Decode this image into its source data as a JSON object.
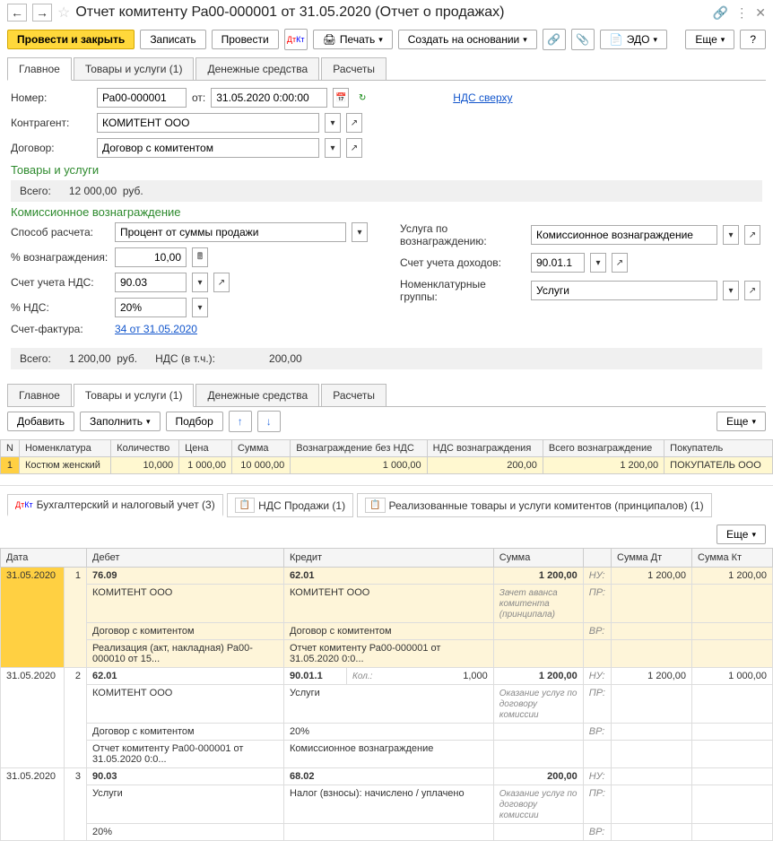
{
  "header": {
    "title": "Отчет комитенту Ра00-000001 от 31.05.2020 (Отчет о продажах)"
  },
  "toolbar": {
    "post_close": "Провести и закрыть",
    "save": "Записать",
    "post": "Провести",
    "print": "Печать",
    "create_based": "Создать на основании",
    "edo": "ЭДО",
    "more": "Еще",
    "help": "?"
  },
  "tabs1": {
    "main": "Главное",
    "goods": "Товары и услуги (1)",
    "money": "Денежные средства",
    "calc": "Расчеты"
  },
  "form": {
    "number_label": "Номер:",
    "number": "Ра00-000001",
    "from_label": "от:",
    "date": "31.05.2020 0:00:00",
    "vat_link": "НДС сверху",
    "contragent_label": "Контрагент:",
    "contragent": "КОМИТЕНТ ООО",
    "contract_label": "Договор:",
    "contract": "Договор с комитентом"
  },
  "goods_section": {
    "title": "Товары и услуги",
    "total_label": "Всего:",
    "total": "12 000,00",
    "currency": "руб."
  },
  "commission": {
    "title": "Комиссионное вознаграждение",
    "method_label": "Способ расчета:",
    "method": "Процент от суммы продажи",
    "service_label": "Услуга по вознаграждению:",
    "service": "Комиссионное вознаграждение",
    "percent_label": "% вознаграждения:",
    "percent": "10,00",
    "income_acct_label": "Счет учета доходов:",
    "income_acct": "90.01.1",
    "vat_acct_label": "Счет учета НДС:",
    "vat_acct": "90.03",
    "nom_group_label": "Номенклатурные группы:",
    "nom_group": "Услуги",
    "vat_rate_label": "% НДС:",
    "vat_rate": "20%",
    "invoice_label": "Счет-фактура:",
    "invoice": "34 от 31.05.2020",
    "totals_label": "Всего:",
    "totals_amount": "1 200,00",
    "totals_currency": "руб.",
    "vat_incl_label": "НДС (в т.ч.):",
    "vat_incl": "200,00"
  },
  "goods_toolbar": {
    "add": "Добавить",
    "fill": "Заполнить",
    "pick": "Подбор",
    "more": "Еще"
  },
  "goods_table": {
    "headers": {
      "n": "N",
      "nom": "Номенклатура",
      "qty": "Количество",
      "price": "Цена",
      "sum": "Сумма",
      "reward_novat": "Вознаграждение без НДС",
      "reward_vat": "НДС вознаграждения",
      "reward_total": "Всего вознаграждение",
      "buyer": "Покупатель"
    },
    "rows": [
      {
        "n": "1",
        "nom": "Костюм женский",
        "qty": "10,000",
        "price": "1 000,00",
        "sum": "10 000,00",
        "reward_novat": "1 000,00",
        "reward_vat": "200,00",
        "reward_total": "1 200,00",
        "buyer": "ПОКУПАТЕЛЬ ООО"
      }
    ]
  },
  "acct_tabs": {
    "acct": "Бухгалтерский и налоговый учет (3)",
    "vat_sales": "НДС Продажи (1)",
    "realized": "Реализованные товары и услуги комитентов (принципалов) (1)"
  },
  "acct_headers": {
    "date": "Дата",
    "debit": "Дебет",
    "credit": "Кредит",
    "sum": "Сумма",
    "sum_dt": "Сумма Дт",
    "sum_kt": "Сумма Кт"
  },
  "acct_rows": [
    {
      "hl": true,
      "date": "31.05.2020",
      "idx": "1",
      "debit": [
        "76.09",
        "КОМИТЕНТ ООО",
        "Договор с комитентом",
        "Реализация (акт, накладная) Ра00-000010 от 15..."
      ],
      "credit": [
        "62.01",
        "КОМИТЕНТ ООО",
        "Договор с комитентом",
        "Отчет комитенту Ра00-000001 от 31.05.2020 0:0..."
      ],
      "sum": "1 200,00",
      "desc": "Зачет аванса комитента (принципала)",
      "nu": "НУ:",
      "pr": "ПР:",
      "vr": "ВР:",
      "sum_dt": "1 200,00",
      "sum_kt": "1 200,00"
    },
    {
      "hl": false,
      "date": "31.05.2020",
      "idx": "2",
      "debit": [
        "62.01",
        "КОМИТЕНТ ООО",
        "Договор с комитентом",
        "Отчет комитенту Ра00-000001 от 31.05.2020 0:0..."
      ],
      "credit_main": "90.01.1",
      "credit_kol_label": "Кол.:",
      "credit_kol": "1,000",
      "credit_lines": [
        "Услуги",
        "20%",
        "Комиссионное вознаграждение"
      ],
      "sum": "1 200,00",
      "desc": "Оказание услуг по договору комиссии",
      "nu": "НУ:",
      "pr": "ПР:",
      "vr": "ВР:",
      "sum_dt": "1 200,00",
      "sum_kt": "1 000,00"
    },
    {
      "hl": false,
      "date": "31.05.2020",
      "idx": "3",
      "debit": [
        "90.03",
        "Услуги",
        "20%"
      ],
      "credit": [
        "68.02",
        "Налог (взносы): начислено / уплачено"
      ],
      "sum": "200,00",
      "desc": "Оказание услуг по договору комиссии",
      "nu": "НУ:",
      "pr": "ПР:",
      "vr": "ВР:"
    }
  ]
}
